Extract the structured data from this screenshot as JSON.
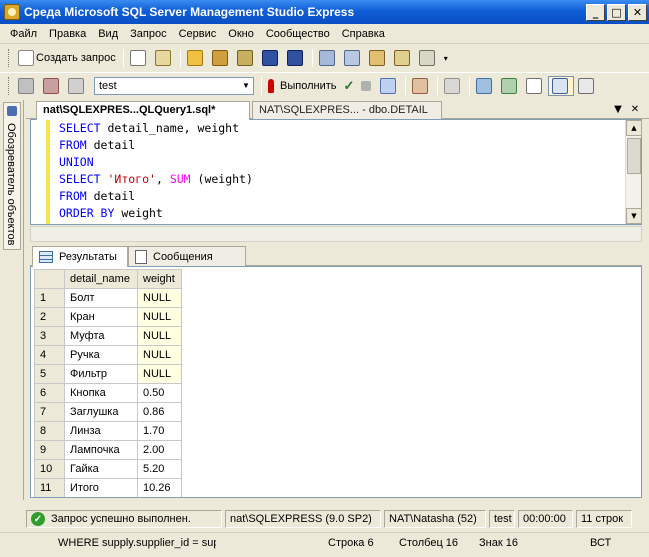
{
  "window": {
    "title": "Среда Microsoft SQL Server Management Studio Express"
  },
  "menu": [
    "Файл",
    "Правка",
    "Вид",
    "Запрос",
    "Сервис",
    "Окно",
    "Сообщество",
    "Справка"
  ],
  "toolbar1": {
    "new_query": "Создать запрос"
  },
  "toolbar2": {
    "database": "test",
    "execute": "Выполнить"
  },
  "side_panel": {
    "label": "Обозреватель объектов"
  },
  "doc_tabs": [
    {
      "label": "nat\\SQLEXPRES...QLQuery1.sql*"
    },
    {
      "label": "NAT\\SQLEXPRES... - dbo.DETAIL"
    }
  ],
  "editor": {
    "lines": [
      [
        {
          "t": "SELECT",
          "c": "kw"
        },
        {
          "t": " detail_name, weight",
          "c": ""
        }
      ],
      [
        {
          "t": "FROM",
          "c": "kw"
        },
        {
          "t": " detail",
          "c": ""
        }
      ],
      [
        {
          "t": "UNION",
          "c": "kw"
        }
      ],
      [
        {
          "t": "SELECT",
          "c": "kw"
        },
        {
          "t": " ",
          "c": ""
        },
        {
          "t": "'Итого'",
          "c": "str"
        },
        {
          "t": ", ",
          "c": ""
        },
        {
          "t": "SUM",
          "c": "fn"
        },
        {
          "t": " (weight)",
          "c": ""
        }
      ],
      [
        {
          "t": "FROM",
          "c": "kw"
        },
        {
          "t": " detail",
          "c": ""
        }
      ],
      [
        {
          "t": "ORDER BY",
          "c": "kw"
        },
        {
          "t": " weight",
          "c": ""
        }
      ]
    ]
  },
  "result_tabs": {
    "results": "Результаты",
    "messages": "Сообщения"
  },
  "results": {
    "columns": [
      "detail_name",
      "weight"
    ],
    "rows": [
      [
        "1",
        "Болт",
        "NULL"
      ],
      [
        "2",
        "Кран",
        "NULL"
      ],
      [
        "3",
        "Муфта",
        "NULL"
      ],
      [
        "4",
        "Ручка",
        "NULL"
      ],
      [
        "5",
        "Фильтр",
        "NULL"
      ],
      [
        "6",
        "Кнопка",
        "0.50"
      ],
      [
        "7",
        "Заглушка",
        "0.86"
      ],
      [
        "8",
        "Линза",
        "1.70"
      ],
      [
        "9",
        "Лампочка",
        "2.00"
      ],
      [
        "10",
        "Гайка",
        "5.20"
      ],
      [
        "11",
        "Итого",
        "10.26"
      ]
    ]
  },
  "query_status": {
    "message": "Запрос успешно выполнен.",
    "server": "nat\\SQLEXPRESS (9.0 SP2)",
    "user": "NAT\\Natasha (52)",
    "database": "test",
    "elapsed": "00:00:00",
    "rows": "11 строк"
  },
  "app_status": {
    "context": "WHERE supply.supplier_id = sup|",
    "line": "Строка 6",
    "column": "Столбец 16",
    "char": "Знак 16",
    "mode": "ВСТ"
  }
}
